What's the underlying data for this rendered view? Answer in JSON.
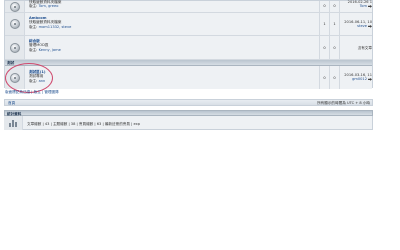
{
  "forums": [
    {
      "name": "",
      "desc": "快取變數資料夾檔案",
      "mods_label": "版主:",
      "mods": "Tom, greeo",
      "topics": "0",
      "posts": "0",
      "last_date": "2016-02-26 1",
      "last_user": "Tom",
      "highlighted": false
    },
    {
      "name": "Ambcom",
      "desc": "快取變數資料夾檔案",
      "mods_label": "版主:",
      "mods": "mom11332, steve",
      "topics": "1",
      "posts": "1",
      "last_date": "2016-06-11, 10",
      "last_user": "steve",
      "highlighted": false
    },
    {
      "name": "綜合版",
      "desc": "管理MOD區",
      "mods_label": "版主:",
      "mods": "Kenny, jame",
      "topics": "0",
      "posts": "0",
      "last_date": "",
      "last_user": "沒有文章",
      "highlighted": false
    },
    {
      "name": "測試區(1)",
      "desc": "測試專用",
      "mods_label": "版主:",
      "mods": "ann",
      "topics": "0",
      "posts": "0",
      "last_date": "2016-03-16, 11",
      "last_user": "gm0012",
      "highlighted": true
    }
  ],
  "category": {
    "label": "測試"
  },
  "links_row": "版面標記為已讀 | 版主 | 管理團隊",
  "footer": {
    "left": "首頁",
    "right": "所有顯示的時間為 UTC + 8 小時"
  },
  "stats": {
    "title": "統計資料",
    "text": "文章總數 | 43 | 主題總數 | 38 | 會員總數 | 63 | 最新註冊的會員 | exp"
  },
  "colors": {
    "accent": "#1f4f8f",
    "highlight": "#cf4a6e",
    "header": "#b9c4cf"
  }
}
